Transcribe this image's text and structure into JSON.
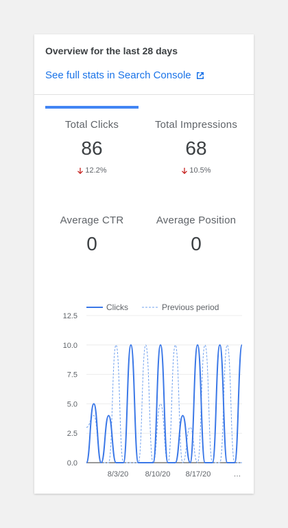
{
  "card": {
    "title": "Overview for the last 28 days",
    "link_label": "See full stats in Search Console"
  },
  "metrics": [
    {
      "label": "Total Clicks",
      "value": "86",
      "change": "12.2%",
      "direction": "down"
    },
    {
      "label": "Total Impressions",
      "value": "68",
      "change": "10.5%",
      "direction": "down"
    },
    {
      "label": "Average CTR",
      "value": "0"
    },
    {
      "label": "Average Position",
      "value": "0"
    }
  ],
  "colors": {
    "accent": "#4285f4",
    "link": "#1a73e8",
    "down": "#c5221f",
    "series_current": "#3b78e7",
    "series_previous": "#6fa0ee"
  },
  "chart_data": {
    "type": "line",
    "legend": [
      "Clicks",
      "Previous period"
    ],
    "legend_position": "top",
    "ylim": [
      0,
      12.5
    ],
    "yticks": [
      "12.5",
      "10.0",
      "7.5",
      "5.0",
      "2.5",
      "0.0"
    ],
    "xticks": [
      "8/3/20",
      "8/10/20",
      "8/17/20",
      "…"
    ],
    "x": [
      "7/27/20",
      "7/28/20",
      "7/29/20",
      "7/30/20",
      "7/31/20",
      "8/1/20",
      "8/2/20",
      "8/3/20",
      "8/4/20",
      "8/5/20",
      "8/6/20",
      "8/7/20",
      "8/8/20",
      "8/9/20",
      "8/10/20",
      "8/11/20",
      "8/12/20",
      "8/13/20",
      "8/14/20",
      "8/15/20",
      "8/16/20",
      "8/17/20",
      "8/18/20",
      "8/19/20",
      "8/20/20",
      "8/21/20",
      "8/22/20",
      "8/23/20"
    ],
    "series": [
      {
        "name": "Clicks",
        "values": [
          0,
          5,
          0,
          4,
          0,
          0,
          10,
          0,
          0,
          0,
          10,
          0,
          0,
          4,
          0,
          10,
          0,
          0,
          10,
          0,
          0,
          10
        ]
      },
      {
        "name": "Previous period",
        "values": [
          3,
          4,
          0,
          0,
          10,
          0,
          0,
          0,
          10,
          0,
          5,
          0,
          10,
          0,
          3,
          0,
          10,
          0,
          0,
          10,
          0,
          0
        ]
      }
    ]
  }
}
